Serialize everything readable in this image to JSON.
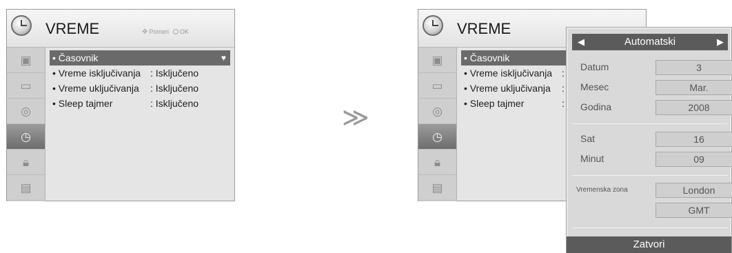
{
  "left_menu": {
    "title": "VREME",
    "nav_hint": {
      "move_label": "Pomeri",
      "ok_label": "OK"
    },
    "categories": [
      {
        "icon": "picture-icon",
        "glyph": "▣",
        "active": false
      },
      {
        "icon": "screen-icon",
        "glyph": "▭",
        "active": false
      },
      {
        "icon": "audio-icon",
        "glyph": "◎",
        "active": false
      },
      {
        "icon": "clock-icon",
        "glyph": "◷",
        "active": true
      },
      {
        "icon": "lock-icon",
        "glyph": "🔒︎",
        "active": false
      },
      {
        "icon": "option-icon",
        "glyph": "▤",
        "active": false
      }
    ],
    "items": [
      {
        "label": "• Časovnik",
        "value": "",
        "selected": true
      },
      {
        "label": "• Vreme isključivanja",
        "value": ": Isključeno",
        "selected": false
      },
      {
        "label": "• Vreme uključivanja",
        "value": ": Isključeno",
        "selected": false
      },
      {
        "label": "• Sleep tajmer",
        "value": ": Isključeno",
        "selected": false
      }
    ]
  },
  "transition_symbol": "≫",
  "right_menu": {
    "title": "VREME",
    "items": [
      {
        "label": "• Časovnik",
        "value": ""
      },
      {
        "label": "• Vreme isključivanja",
        "value": ":"
      },
      {
        "label": "• Vreme uključivanja",
        "value": ":"
      },
      {
        "label": "• Sleep tajmer",
        "value": ":"
      }
    ]
  },
  "clock_popup": {
    "mode": "Automatski",
    "fields": {
      "datum": {
        "label": "Datum",
        "value": "3"
      },
      "mesec": {
        "label": "Mesec",
        "value": "Mar."
      },
      "godina": {
        "label": "Godina",
        "value": "2008"
      },
      "sat": {
        "label": "Sat",
        "value": "16"
      },
      "minut": {
        "label": "Minut",
        "value": "09"
      },
      "zona": {
        "label": "Vremenska zona",
        "value": "London",
        "value2": "GMT"
      }
    },
    "close_label": "Zatvori"
  }
}
